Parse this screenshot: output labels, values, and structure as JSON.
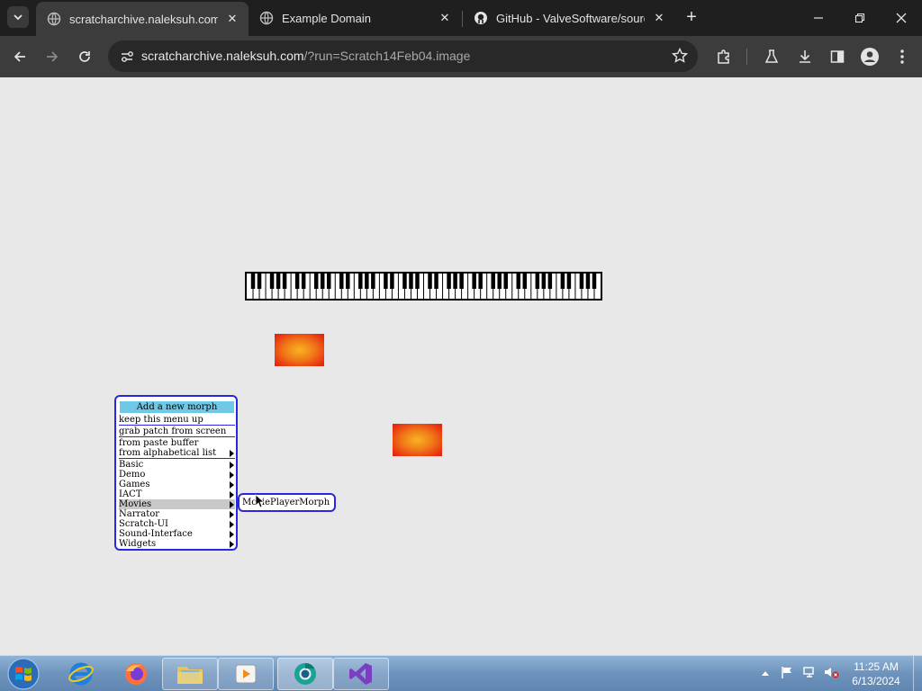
{
  "browser": {
    "tabs": [
      {
        "title": "scratcharchive.naleksuh.com/?",
        "active": true
      },
      {
        "title": "Example Domain",
        "active": false
      },
      {
        "title": "GitHub - ValveSoftware/sourc",
        "active": false
      }
    ],
    "url_host": "scratcharchive.naleksuh.com",
    "url_path": "/?run=Scratch14Feb04.image"
  },
  "morph_menu": {
    "title": "Add a new morph",
    "items": [
      {
        "label": "keep this menu up",
        "submenu": false
      },
      {
        "label": "grab patch from screen",
        "submenu": false
      },
      {
        "label": "from paste buffer",
        "submenu": false
      },
      {
        "label": "from alphabetical list",
        "submenu": true
      },
      {
        "label": "Basic",
        "submenu": true
      },
      {
        "label": "Demo",
        "submenu": true
      },
      {
        "label": "Games",
        "submenu": true
      },
      {
        "label": "IACT",
        "submenu": true
      },
      {
        "label": "Movies",
        "submenu": true,
        "highlighted": true
      },
      {
        "label": "Narrator",
        "submenu": true
      },
      {
        "label": "Scratch-UI",
        "submenu": true
      },
      {
        "label": "Sound-Interface",
        "submenu": true
      },
      {
        "label": "Widgets",
        "submenu": true
      }
    ]
  },
  "submenu": {
    "items": [
      "MoviePlayerMorph"
    ]
  },
  "taskbar": {
    "apps": [
      "internet-explorer",
      "firefox",
      "file-explorer",
      "media-player",
      "chrome-canary",
      "visual-studio"
    ],
    "time": "11:25 AM",
    "date": "6/13/2024"
  },
  "colors": {
    "menu_border": "#2828e0",
    "menu_title_bg": "#6ec8e6",
    "patch_center": "#f6b520",
    "patch_edge": "#e02010"
  }
}
